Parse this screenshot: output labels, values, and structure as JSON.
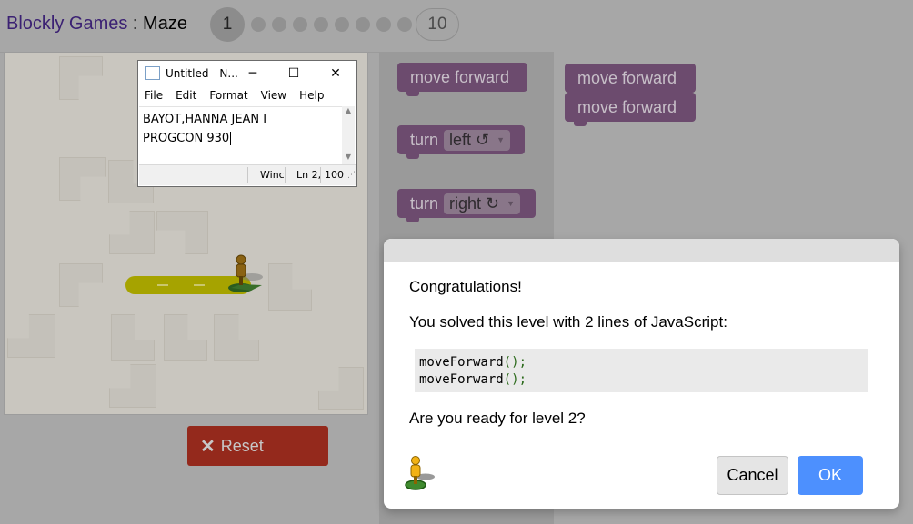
{
  "header": {
    "app_name": "Blockly Games",
    "separator": " : ",
    "game_name": "Maze",
    "levels": {
      "current": "1",
      "last": "10"
    }
  },
  "maze": {
    "reset_label": "Reset"
  },
  "toolbox": {
    "move_forward": "move forward",
    "turn": "turn",
    "left": "left ↺",
    "right": "right ↻"
  },
  "workspace": {
    "blocks": [
      "move forward",
      "move forward"
    ]
  },
  "notepad": {
    "title": "Untitled - N...",
    "menu": [
      "File",
      "Edit",
      "Format",
      "View",
      "Help"
    ],
    "lines": [
      "BAYOT,HANNA JEAN I",
      "PROGCON 930"
    ],
    "status": {
      "encoding": "Winc",
      "position": "Ln 2,",
      "zoom": "100"
    }
  },
  "dialog": {
    "congrats": "Congratulations!",
    "solved": "You solved this level with 2 lines of JavaScript:",
    "code_lines": [
      "moveForward",
      "moveForward"
    ],
    "code_suffix": "();",
    "ready": "Are you ready for level 2?",
    "cancel": "Cancel",
    "ok": "OK"
  },
  "colors": {
    "block": "#6c4b6e",
    "ok": "#4d90fe",
    "reset": "#94291c"
  }
}
